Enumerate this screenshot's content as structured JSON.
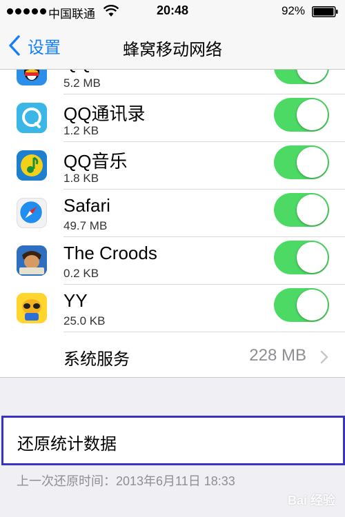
{
  "status_bar": {
    "carrier": "中国联通",
    "time": "20:48",
    "battery": "92%"
  },
  "nav": {
    "back_label": "设置",
    "title": "蜂窝移动网络"
  },
  "apps": [
    {
      "name": "QQ",
      "size": "5.2 MB",
      "enabled": true,
      "icon": "qq-penguin-icon"
    },
    {
      "name": "QQ通讯录",
      "size": "1.2 KB",
      "enabled": true,
      "icon": "qq-contacts-icon"
    },
    {
      "name": "QQ音乐",
      "size": "1.8 KB",
      "enabled": true,
      "icon": "qq-music-icon"
    },
    {
      "name": "Safari",
      "size": "49.7 MB",
      "enabled": true,
      "icon": "safari-compass-icon"
    },
    {
      "name": "The Croods",
      "size": "0.2 KB",
      "enabled": true,
      "icon": "croods-game-icon"
    },
    {
      "name": "YY",
      "size": "25.0 KB",
      "enabled": true,
      "icon": "yy-raccoon-icon"
    }
  ],
  "system_services": {
    "label": "系统服务",
    "value": "228 MB"
  },
  "reset": {
    "label": "还原统计数据",
    "last_reset": "上一次还原时间：2013年6月11日 18:33"
  },
  "watermark": "Bai 经验",
  "colors": {
    "toggle_on": "#4cd964",
    "accent": "#147efb",
    "highlight_border": "#3834c2"
  }
}
